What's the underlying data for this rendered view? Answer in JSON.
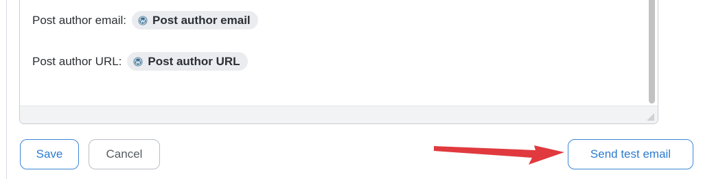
{
  "fields": [
    {
      "label": "Post author email:",
      "chip_text": "Post author email",
      "chip_icon": "wordpress-icon"
    },
    {
      "label": "Post author URL:",
      "chip_text": "Post author URL",
      "chip_icon": "wordpress-icon"
    }
  ],
  "actions": {
    "save_label": "Save",
    "cancel_label": "Cancel",
    "send_test_label": "Send test email"
  },
  "annotation": {
    "arrow_icon": "red-arrow-icon",
    "arrow_color": "#e03a3e"
  },
  "colors": {
    "accent": "#2b7bd0",
    "chip_bg": "#eaecef"
  }
}
